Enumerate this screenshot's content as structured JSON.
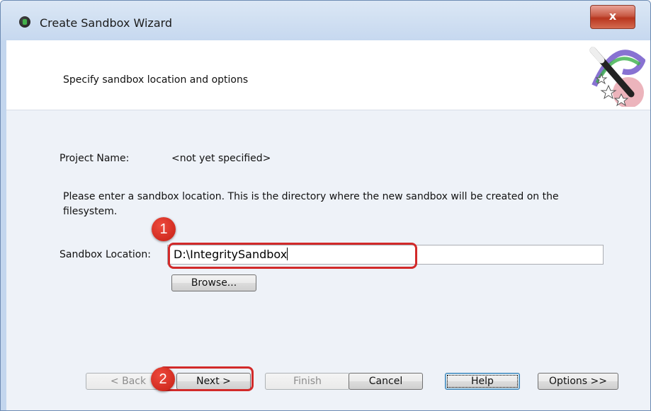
{
  "window": {
    "title": "Create Sandbox Wizard",
    "close_label": "x"
  },
  "banner": {
    "heading": "Specify sandbox location and options",
    "icon": "magic-wand-icon"
  },
  "form": {
    "project_name_label": "Project Name:",
    "project_name_value": "<not yet specified>",
    "instructions": "Please enter a sandbox location.  This is the directory where the new sandbox will be created on the filesystem.",
    "sandbox_location_label": "Sandbox Location:",
    "sandbox_location_value": "D:\\IntegritySandbox",
    "browse_label": "Browse..."
  },
  "buttons": {
    "back": "< Back",
    "next": "Next >",
    "finish": "Finish",
    "cancel": "Cancel",
    "help": "Help",
    "options": "Options >>"
  },
  "annotations": {
    "step1": "1",
    "step2": "2"
  },
  "colors": {
    "highlight": "#d22a2a",
    "close_button": "#c85a45",
    "panel": "#eef2f8"
  }
}
